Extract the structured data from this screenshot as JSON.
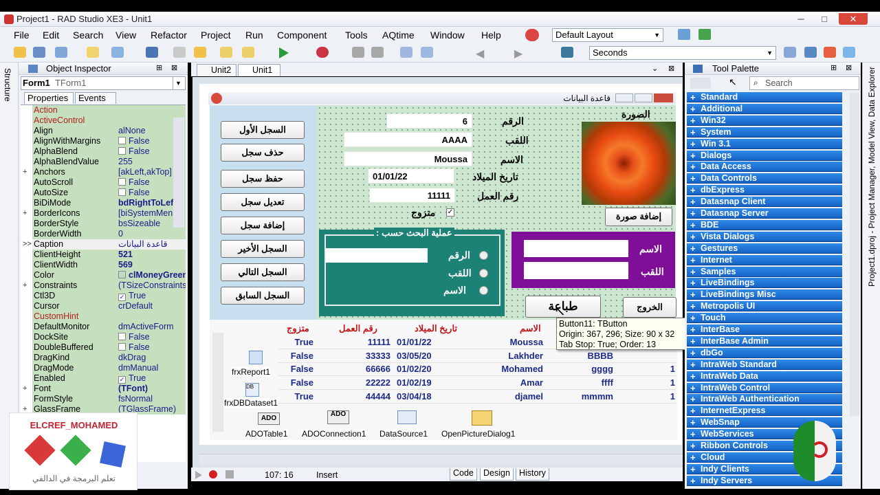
{
  "window": {
    "title": "Project1 - RAD Studio XE3 - Unit1",
    "min": "─",
    "max": "□",
    "close": "✕"
  },
  "menu": [
    "File",
    "Edit",
    "Search",
    "View",
    "Refactor",
    "Project",
    "Run",
    "Component",
    "Tools",
    "AQtime",
    "Window",
    "Help"
  ],
  "layout_combo": "Default Layout",
  "seconds_combo": "Seconds",
  "structure_label": "Structure",
  "object_inspector": {
    "title": "Object Inspector",
    "selected": "Form1",
    "selected_type": "TForm1",
    "tab_properties": "Properties",
    "tab_events": "Events",
    "props": [
      {
        "n": "Action",
        "v": "",
        "red": true
      },
      {
        "n": "ActiveControl",
        "v": "",
        "red": true
      },
      {
        "n": "Align",
        "v": "alNone"
      },
      {
        "n": "AlignWithMargins",
        "v": "False",
        "chk": true
      },
      {
        "n": "AlphaBlend",
        "v": "False",
        "chk": true
      },
      {
        "n": "AlphaBlendValue",
        "v": "255"
      },
      {
        "n": "Anchors",
        "v": "[akLeft,akTop]",
        "plus": true
      },
      {
        "n": "AutoScroll",
        "v": "False",
        "chk": true
      },
      {
        "n": "AutoSize",
        "v": "False",
        "chk": true
      },
      {
        "n": "BiDiMode",
        "v": "bdRightToLeft",
        "b": true
      },
      {
        "n": "BorderIcons",
        "v": "[biSystemMenu]",
        "plus": true
      },
      {
        "n": "BorderStyle",
        "v": "bsSizeable"
      },
      {
        "n": "BorderWidth",
        "v": "0"
      },
      {
        "n": "Caption",
        "v": "قاعدة البيانات",
        "sel": true,
        "mark": ">>"
      },
      {
        "n": "ClientHeight",
        "v": "521",
        "b": true
      },
      {
        "n": "ClientWidth",
        "v": "569",
        "b": true
      },
      {
        "n": "Color",
        "v": "clMoneyGreen",
        "b": true,
        "swatch": true
      },
      {
        "n": "Constraints",
        "v": "(TSizeConstraints)",
        "plus": true
      },
      {
        "n": "Ctl3D",
        "v": "True",
        "chk": true,
        "checked": true
      },
      {
        "n": "Cursor",
        "v": "crDefault"
      },
      {
        "n": "CustomHint",
        "v": "",
        "red": true
      },
      {
        "n": "DefaultMonitor",
        "v": "dmActiveForm"
      },
      {
        "n": "DockSite",
        "v": "False",
        "chk": true
      },
      {
        "n": "DoubleBuffered",
        "v": "False",
        "chk": true
      },
      {
        "n": "DragKind",
        "v": "dkDrag"
      },
      {
        "n": "DragMode",
        "v": "dmManual"
      },
      {
        "n": "Enabled",
        "v": "True",
        "chk": true,
        "checked": true
      },
      {
        "n": "Font",
        "v": "(TFont)",
        "plus": true,
        "b": true
      },
      {
        "n": "FormStyle",
        "v": "fsNormal"
      },
      {
        "n": "GlassFrame",
        "v": "(TGlassFrame)",
        "plus": true
      }
    ]
  },
  "designer_tabs": [
    "Unit2",
    "Unit1"
  ],
  "form": {
    "title": "قاعدة البيانات",
    "buttons": [
      "السجل الأول",
      "حذف سجل",
      "حفظ سجل",
      "تعديل سجل",
      "إضافة سجل",
      "السجل الأخير",
      "السجل التالي",
      "السجل السابق"
    ],
    "labels": {
      "num": "الرقم",
      "title": "اللقب",
      "name": "الاسم",
      "birth": "تاريخ الميلاد",
      "work": "رقم العمل",
      "married": "متزوج",
      "photo": "الصورة",
      "add_photo": "إضافة صورة",
      "search_group": "عملية البحث حسب :",
      "r_num": "الرقم",
      "r_title": "اللقب",
      "r_name": "الاسم",
      "p_name": "الاسم",
      "p_title": "اللقب",
      "print": "طباعة",
      "exit": "الخروج"
    },
    "values": {
      "num": "6",
      "title": "AAAA",
      "name": "Moussa",
      "birth": "01/01/22",
      "work": "11111"
    },
    "grid_headers": [
      "متزوج",
      "رقم العمل",
      "تاريخ الميلاد",
      "الاسم"
    ],
    "grid_rows": [
      {
        "m": "True",
        "w": "11111",
        "d": "01/01/22",
        "n": "Moussa",
        "t": "",
        "x": ""
      },
      {
        "m": "False",
        "w": "33333",
        "d": "03/05/20",
        "n": "Lakhder",
        "t": "BBBB",
        "x": ""
      },
      {
        "m": "False",
        "w": "66666",
        "d": "01/02/20",
        "n": "Mohamed",
        "t": "gggg",
        "x": "1"
      },
      {
        "m": "False",
        "w": "22222",
        "d": "01/02/19",
        "n": "Amar",
        "t": "ffff",
        "x": "1"
      },
      {
        "m": "True",
        "w": "44444",
        "d": "03/04/18",
        "n": "djamel",
        "t": "mmmm",
        "x": "1"
      }
    ],
    "components": [
      "frxReport1",
      "frxDBDataset1",
      "ADOTable1",
      "ADOConnection1",
      "DataSource1",
      "OpenPictureDialog1"
    ],
    "tooltip": [
      "Button11: TButton",
      "Origin: 367, 296; Size: 90 x 32",
      "Tab Stop: True; Order: 13"
    ]
  },
  "status": {
    "pos": "107:  16",
    "mode": "Insert",
    "tabs": [
      "Code",
      "Design",
      "History"
    ]
  },
  "palette": {
    "title": "Tool Palette",
    "search": "Search",
    "items": [
      "Standard",
      "Additional",
      "Win32",
      "System",
      "Win 3.1",
      "Dialogs",
      "Data Access",
      "Data Controls",
      "dbExpress",
      "Datasnap Client",
      "Datasnap Server",
      "BDE",
      "Vista Dialogs",
      "Gestures",
      "Internet",
      "Samples",
      "LiveBindings",
      "LiveBindings Misc",
      "Metropolis UI",
      "Touch",
      "InterBase",
      "InterBase Admin",
      "dbGo",
      "IntraWeb Standard",
      "IntraWeb Data",
      "IntraWeb Control",
      "IntraWeb Authentication",
      "InternetExpress",
      "WebSnap",
      "WebServices",
      "Ribbon Controls",
      "Cloud",
      "Indy Clients",
      "Indy Servers"
    ]
  },
  "right_vertical": "Project1.dproj - Project Manager, Model View, Data Explorer",
  "watermark": {
    "title": "ELCREF_MOHAMED",
    "subtitle": "تعلم البرمجة في الدالفي"
  }
}
